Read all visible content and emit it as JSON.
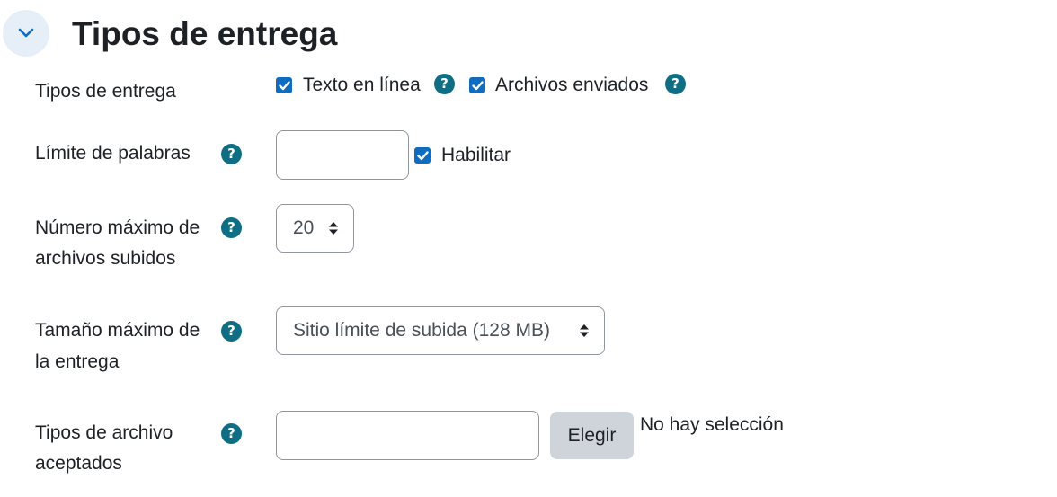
{
  "section": {
    "title": "Tipos de entrega"
  },
  "submission_types": {
    "label": "Tipos de entrega",
    "online_text_label": "Texto en línea",
    "online_text_checked": true,
    "file_submissions_label": "Archivos enviados",
    "file_submissions_checked": true
  },
  "word_limit": {
    "label": "Límite de palabras",
    "value": "",
    "enable_label": "Habilitar",
    "enable_checked": true
  },
  "max_files": {
    "label_line1": "Número máximo de",
    "label_line2": "archivos subidos",
    "selected": "20"
  },
  "max_size": {
    "label_line1": "Tamaño máximo de",
    "label_line2": "la entrega",
    "selected": "Sitio límite de subida (128 MB)"
  },
  "accepted_types": {
    "label_line1": "Tipos de archivo",
    "label_line2": "aceptados",
    "value": "",
    "choose_button": "Elegir",
    "status": "No hay selección"
  },
  "colors": {
    "accent": "#0f6cbf",
    "help_icon": "#0f6e84",
    "collapse_bg": "#e6eef8",
    "button_bg": "#ced4da"
  }
}
